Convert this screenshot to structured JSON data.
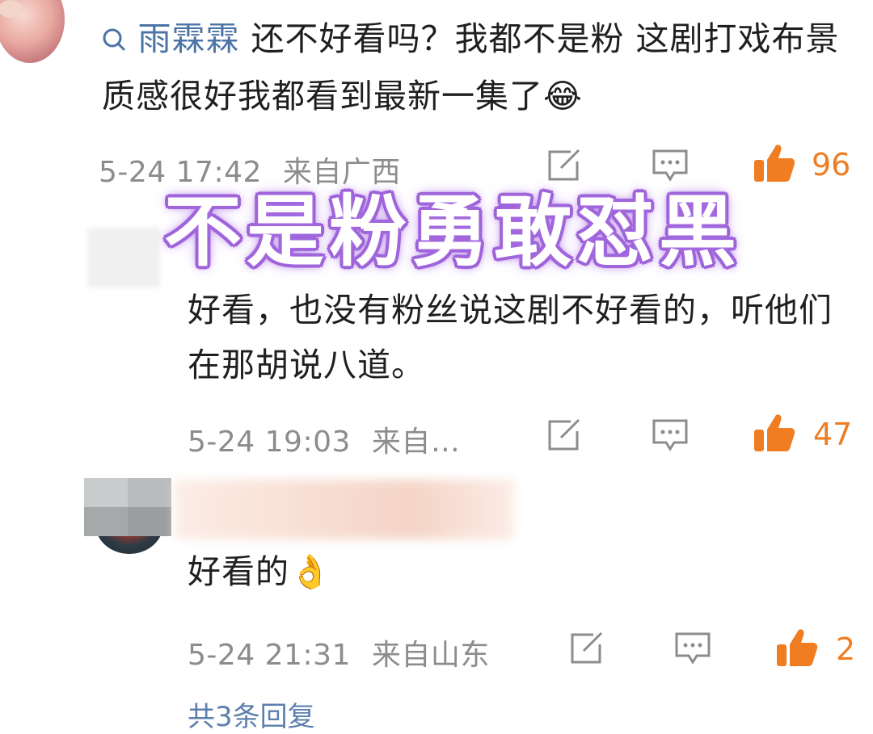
{
  "comments": [
    {
      "username": "雨霖霖",
      "text": "还不好看吗？我都不是粉 这剧打戏布景质感很好我都看到最新一集了",
      "emoji": "😂",
      "time": "5-24 17:42",
      "location": "来自广西",
      "likes": "96"
    },
    {
      "text": "好看，也没有粉丝说这剧不好看的，听他们在那胡说八道。",
      "time": "5-24 19:03",
      "location": "来自…",
      "likes": "47"
    },
    {
      "text": "好看的",
      "emoji": "👌",
      "time": "5-24 21:31",
      "location": "来自山东",
      "likes": "2"
    }
  ],
  "overlay_headline": "不是粉勇敢怼黑",
  "bottom_link": "共3条回复",
  "colors": {
    "username": "#4a73a6",
    "meta": "#8c8c8c",
    "like": "#f07d22",
    "headline_outline": "#9b5fd6"
  },
  "icons": [
    "search-icon",
    "share-icon",
    "comment-icon",
    "thumbs-up-icon"
  ]
}
